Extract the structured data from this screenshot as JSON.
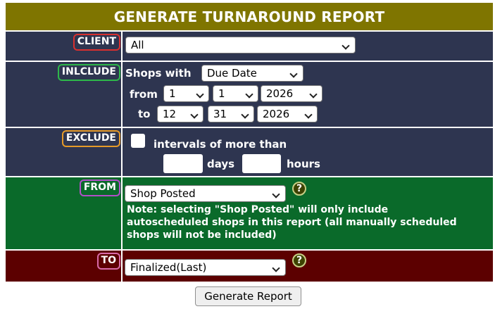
{
  "header": {
    "title": "GENERATE TURNAROUND REPORT"
  },
  "client": {
    "label": "CLIENT",
    "value": "All"
  },
  "include": {
    "label": "INLCLUDE",
    "shops_with_text": "Shops with",
    "date_type": "Due Date",
    "from_text": "from",
    "from_month": "1",
    "from_day": "1",
    "from_year": "2026",
    "to_text": "to",
    "to_month": "12",
    "to_day": "31",
    "to_year": "2026"
  },
  "exclude": {
    "label": "EXCLUDE",
    "checked": false,
    "intervals_text": "intervals of more than",
    "days_value": "",
    "days_text": "days",
    "hours_value": "",
    "hours_text": "hours"
  },
  "from": {
    "label": "FROM",
    "value": "Shop Posted",
    "note": "Note: selecting \"Shop Posted\" will only include autoscheduled shops in this report (all manually scheduled shops will not be included)",
    "help_icon": "?"
  },
  "to": {
    "label": "TO",
    "value": "Finalized(Last)",
    "help_icon": "?"
  },
  "actions": {
    "generate_label": "Generate Report"
  },
  "colors": {
    "header_bg": "#7f7500",
    "row_navy": "#2e3550",
    "row_green": "#0a6a2a",
    "row_maroon": "#5c0000",
    "client_border": "#d9302f",
    "include_border": "#2eb84a",
    "exclude_border": "#e69a28",
    "from_border": "#b24fc8",
    "to_border": "#d86aa8"
  }
}
